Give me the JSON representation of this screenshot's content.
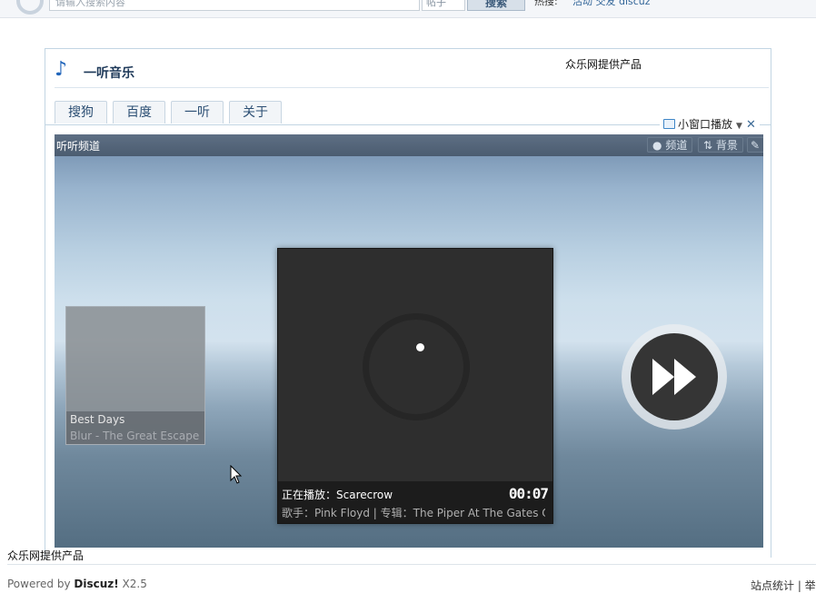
{
  "topbar": {
    "search_placeholder": "请输入搜索内容",
    "search_type": "帖子",
    "search_button": "搜索",
    "hot_label": "热搜:",
    "hot_links": "活动 交友 discuz"
  },
  "app": {
    "title": "一听音乐",
    "provider": "众乐网提供产品",
    "tabs": [
      "搜狗",
      "百度",
      "一听",
      "关于"
    ],
    "mini_player": "小窗口播放"
  },
  "player": {
    "channel_title": "听听频道",
    "channel_button": "频道",
    "background_button": "背景",
    "edit_icon": "pencil-icon",
    "previous_song": {
      "title": "Best Days",
      "subtitle": "Blur - The Great Escape"
    },
    "now_playing": {
      "line1": "正在播放：Scarecrow",
      "time": "00:07",
      "line2": "歌手：Pink Floyd | 专辑：The Piper At The Gates Of"
    },
    "next_icon": "fast-forward-icon"
  },
  "footer": {
    "provider": "众乐网提供产品",
    "powered_prefix": "Powered by ",
    "powered_brand": "Discuz!",
    "powered_version": " X2.5",
    "right_links": "站点统计 | 举"
  },
  "colors": {
    "accent": "#2266bb",
    "border": "#c2d5e3",
    "player_bar": "#4b5c70",
    "card_bg": "#2e2e2e"
  }
}
